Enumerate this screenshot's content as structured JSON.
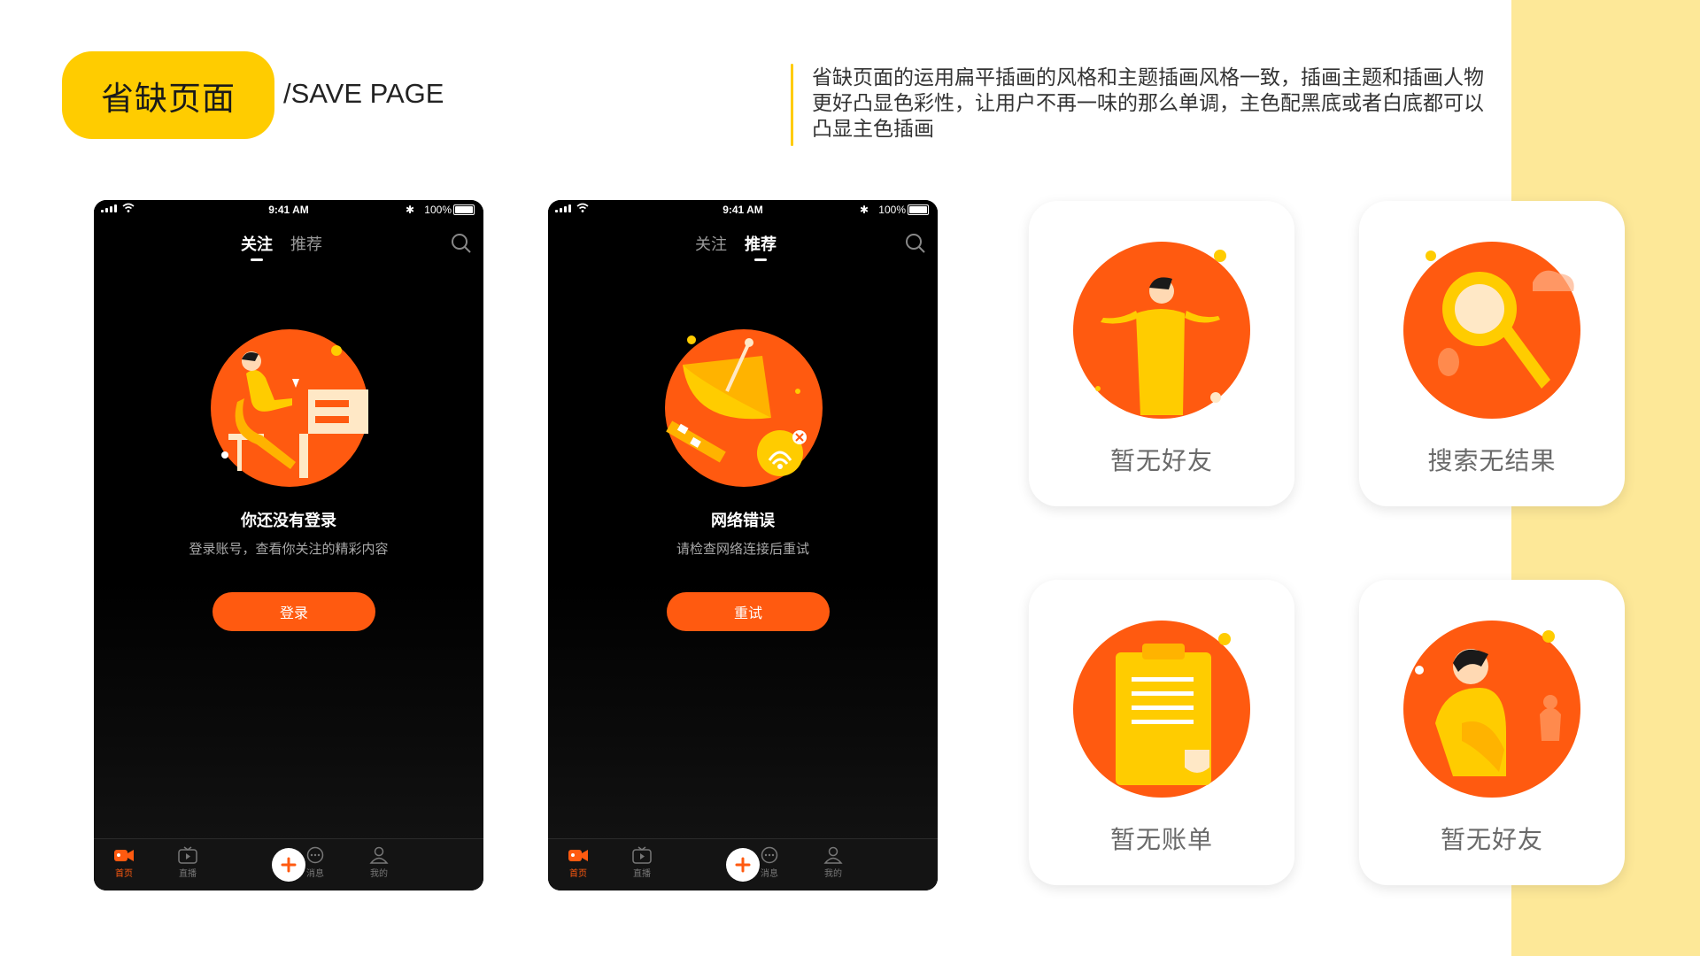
{
  "header": {
    "title": "省缺页面",
    "subtitle": "/SAVE PAGE",
    "description": "省缺页面的运用扁平插画的风格和主题插画风格一致，插画主题和插画人物更好凸显色彩性，让用户不再一味的那么单调，主色配黑底或者白底都可以凸显主色插画"
  },
  "colors": {
    "accent_yellow": "#ffcc00",
    "accent_orange": "#ff5a10",
    "band": "#fde898"
  },
  "phones": [
    {
      "status": {
        "time": "9:41 AM",
        "battery": "100%"
      },
      "tabs": [
        {
          "label": "关注",
          "active": true
        },
        {
          "label": "推荐",
          "active": false
        }
      ],
      "illustration": "person-sitting-at-desk-illustration",
      "title": "你还没有登录",
      "subtitle": "登录账号，查看你关注的精彩内容",
      "button": "登录",
      "tabbar": [
        "首页",
        "直播",
        "消息",
        "我的"
      ],
      "active_tab": "首页"
    },
    {
      "status": {
        "time": "9:41 AM",
        "battery": "100%"
      },
      "tabs": [
        {
          "label": "关注",
          "active": false
        },
        {
          "label": "推荐",
          "active": true
        }
      ],
      "illustration": "satellite-dish-wifi-illustration",
      "title": "网络错误",
      "subtitle": "请检查网络连接后重试",
      "button": "重试",
      "tabbar": [
        "首页",
        "直播",
        "消息",
        "我的"
      ],
      "active_tab": "首页"
    }
  ],
  "cards": [
    {
      "label": "暂无好友",
      "illustration": "shrugging-person-illustration"
    },
    {
      "label": "搜索无结果",
      "illustration": "magnifier-illustration"
    },
    {
      "label": "暂无账单",
      "illustration": "clipboard-illustration"
    },
    {
      "label": "暂无好友",
      "illustration": "sitting-person-illustration"
    }
  ]
}
